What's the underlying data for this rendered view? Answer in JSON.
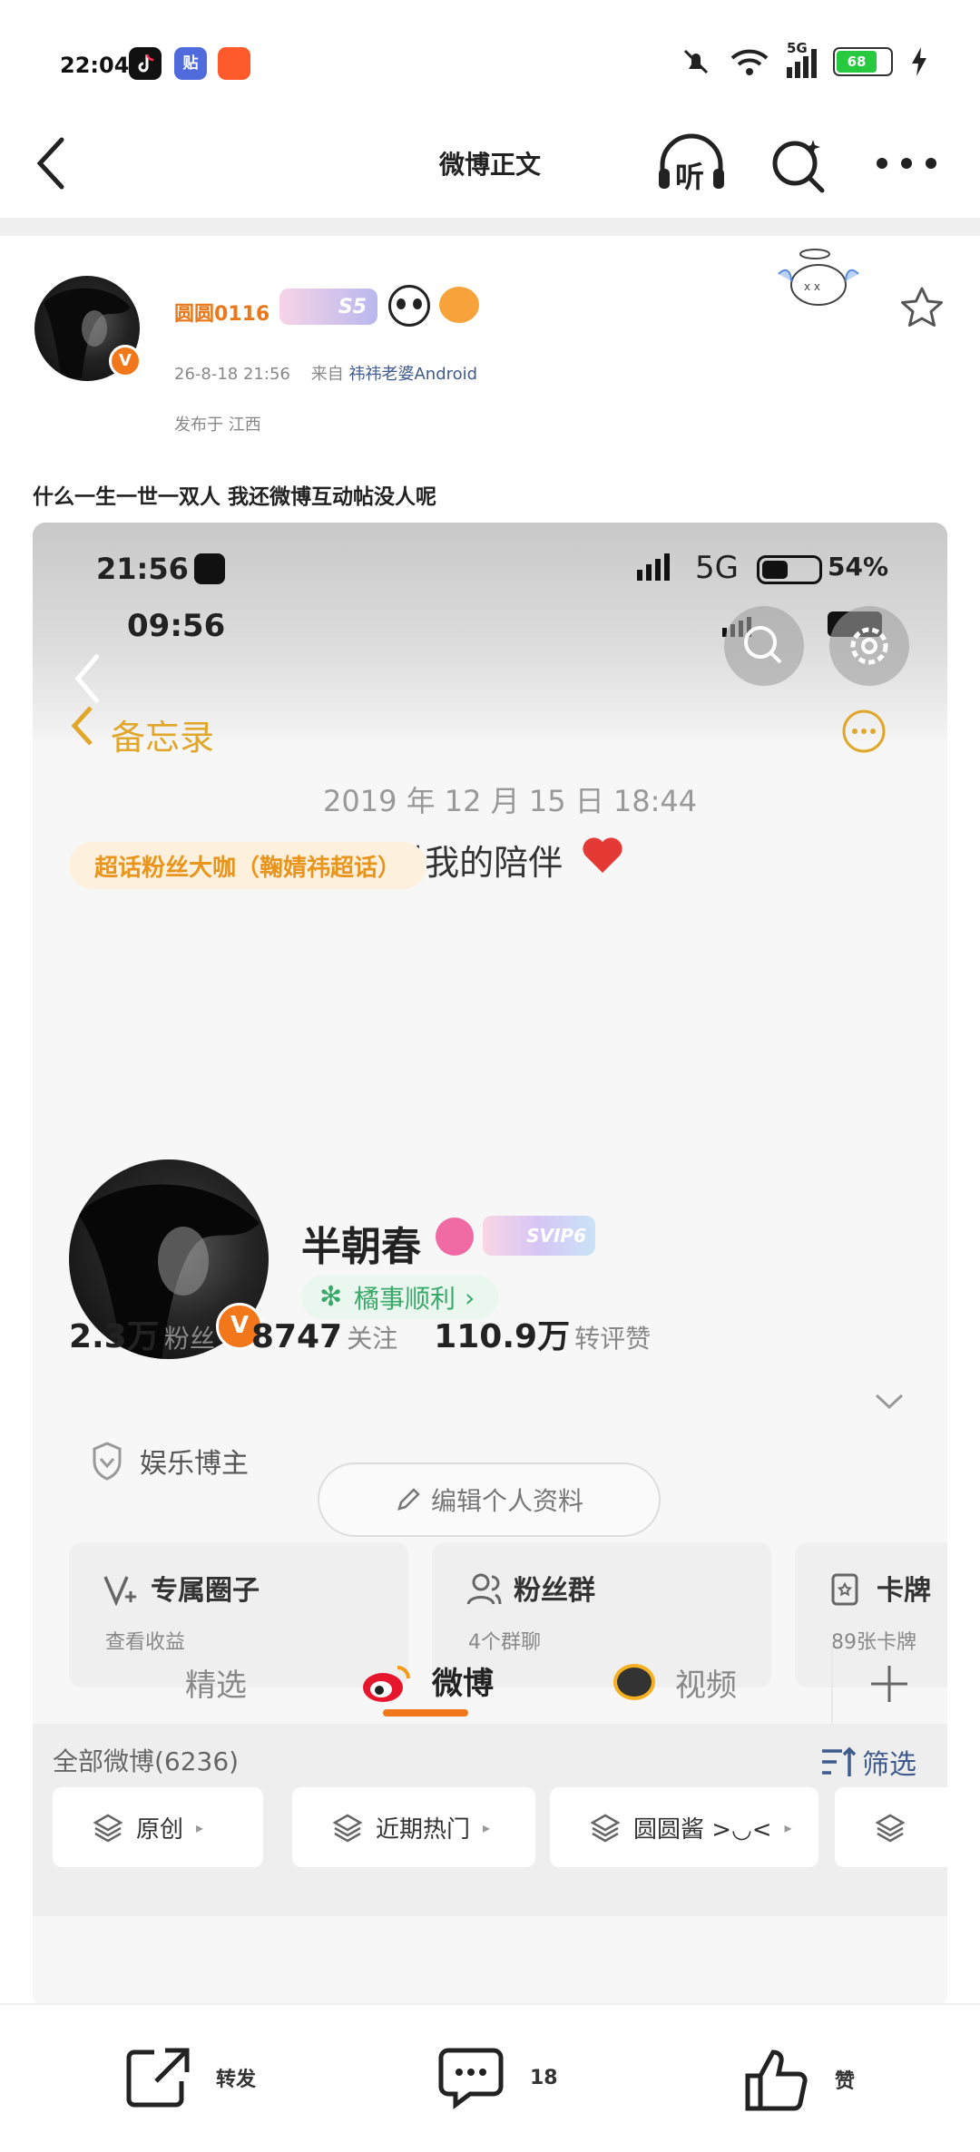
{
  "status_bar": {
    "time": "22:04",
    "network": "5G",
    "battery": "68"
  },
  "nav": {
    "title": "微博正文",
    "listen_label": "听"
  },
  "post": {
    "username": "圆圆0116",
    "level_badge": "S5",
    "time": "26-8-18 21:56",
    "source_prefix": "来自",
    "source": "祎祎老婆Android",
    "location": "发布于 江西",
    "text": "什么一生一世一双人 我还微博互动帖没人呢"
  },
  "screenshot": {
    "status_time": "21:56",
    "status_network": "5G",
    "status_battery": "54%",
    "inner_time": "09:56",
    "memo_back": "备忘录",
    "memo_date": "2019 年 12 月 15 日 18:44",
    "memo_text": "感谢陪伴 感谢只是对我的陪伴",
    "profile": {
      "name": "半朝春",
      "vip": "SVIP6",
      "tag": "橘事顺利",
      "stats": [
        {
          "value": "2.3万",
          "label": "粉丝"
        },
        {
          "value": "8747",
          "label": "关注"
        },
        {
          "value": "110.9万",
          "label": "转评赞"
        }
      ],
      "super_fan": "超话粉丝大咖（鞠婧祎超话）",
      "role": "娱乐博主",
      "edit_button": "编辑个人资料"
    },
    "cards": [
      {
        "title": "专属圈子",
        "sub": "查看收益"
      },
      {
        "title": "粉丝群",
        "sub": "4个群聊"
      },
      {
        "title": "卡牌",
        "sub": "89张卡牌"
      }
    ],
    "tabs": [
      "精选",
      "微博",
      "视频"
    ],
    "active_tab": "微博",
    "all_posts": "全部微博(6236)",
    "filter": "筛选",
    "chips": [
      "原创",
      "近期热门",
      "圆圆酱 >◡<"
    ]
  },
  "bottom_bar": {
    "repost": "转发",
    "comment_count": "18",
    "like": "赞"
  },
  "colors": {
    "accent": "#f2771b",
    "link": "#3f5b8c",
    "active_tab_underline": "#f2771b"
  }
}
